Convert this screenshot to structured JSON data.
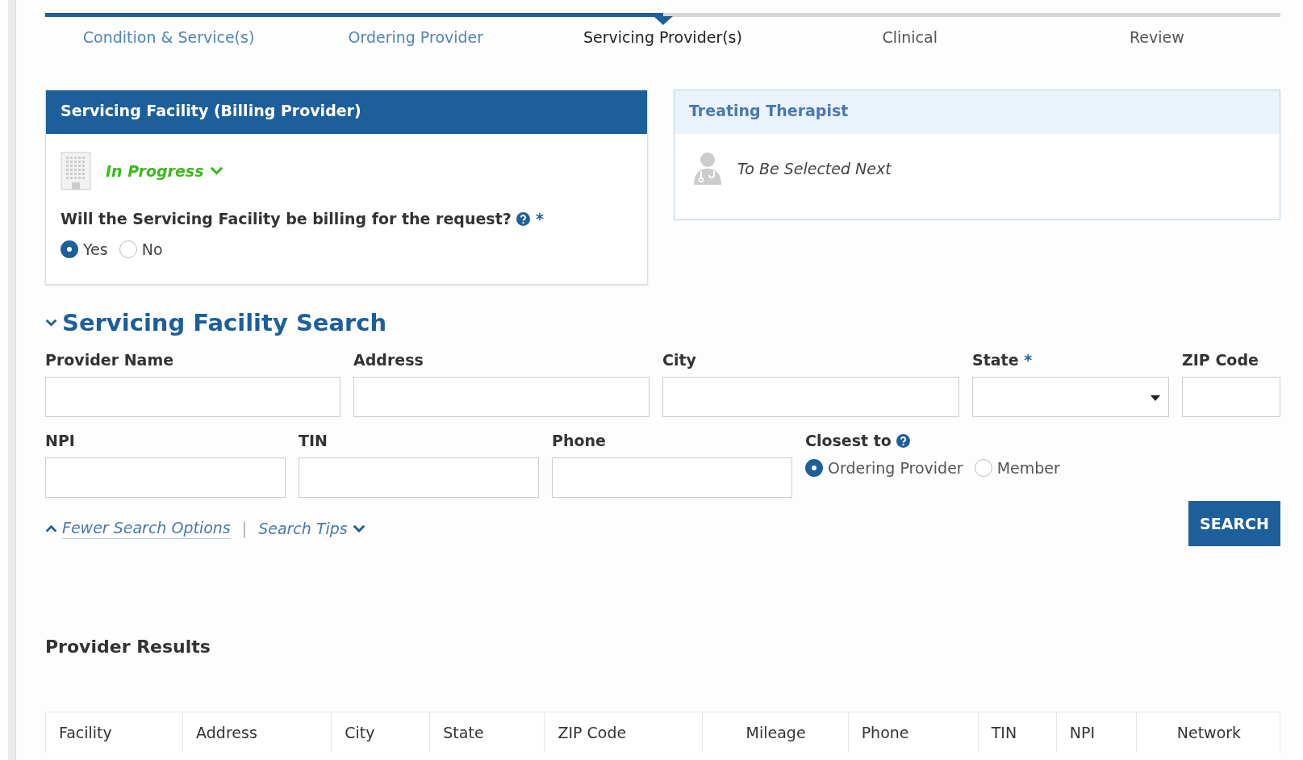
{
  "steps": [
    {
      "label": "Condition & Service(s)",
      "done": true,
      "selected": false
    },
    {
      "label": "Ordering Provider",
      "done": true,
      "selected": false
    },
    {
      "label": "Servicing Provider(s)",
      "done": false,
      "selected": true
    },
    {
      "label": "Clinical",
      "done": false,
      "selected": false
    },
    {
      "label": "Review",
      "done": false,
      "selected": false
    }
  ],
  "facility_card": {
    "title": "Servicing Facility (Billing Provider)",
    "status": "In Progress",
    "question": "Will the Servicing Facility be billing for the request?",
    "required_mark": "*",
    "options": [
      {
        "label": "Yes",
        "selected": true
      },
      {
        "label": "No",
        "selected": false
      }
    ]
  },
  "therapist_card": {
    "title": "Treating Therapist",
    "status": "To Be Selected Next"
  },
  "search": {
    "title": "Servicing Facility Search",
    "expanded": true,
    "rows": [
      [
        {
          "kind": "text",
          "label": "Provider Name"
        },
        {
          "kind": "text",
          "label": "Address"
        },
        {
          "kind": "text",
          "label": "City"
        },
        {
          "kind": "select",
          "label": "State",
          "required_mark": "*"
        },
        {
          "kind": "text",
          "label": "ZIP Code"
        }
      ],
      [
        {
          "kind": "text",
          "label": "NPI"
        },
        {
          "kind": "text",
          "label": "TIN"
        },
        {
          "kind": "text",
          "label": "Phone"
        },
        {
          "kind": "radio",
          "label": "Closest to",
          "help": true,
          "options": [
            {
              "label": "Ordering Provider",
              "selected": true
            },
            {
              "label": "Member",
              "selected": false
            }
          ]
        }
      ]
    ],
    "fewer_options_link": "Fewer Search Options",
    "separator": "|",
    "tips_link": "Search Tips",
    "button": "SEARCH"
  },
  "results": {
    "title": "Provider Results",
    "columns": [
      "Facility",
      "Address",
      "City",
      "State",
      "ZIP Code",
      "Mileage",
      "Phone",
      "TIN",
      "NPI",
      "Network"
    ]
  }
}
